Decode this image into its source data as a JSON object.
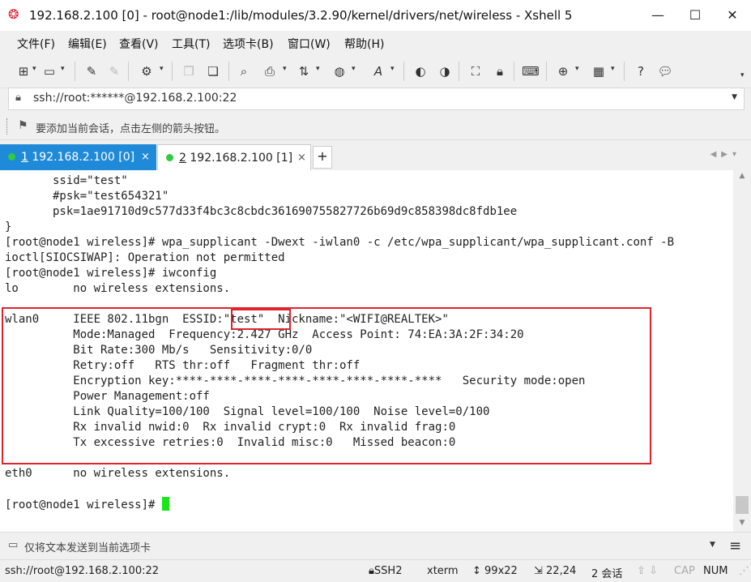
{
  "window": {
    "title": "192.168.2.100 [0] - root@node1:/lib/modules/3.2.90/kernel/drivers/net/wireless - Xshell 5",
    "app_icon": "xshell-logo-icon",
    "minimize_glyph": "—",
    "maximize_glyph": "☐",
    "close_glyph": "✕"
  },
  "menu": {
    "items": [
      "文件(F)",
      "编辑(E)",
      "查看(V)",
      "工具(T)",
      "选项卡(B)",
      "窗口(W)",
      "帮助(H)"
    ]
  },
  "toolbar": {
    "icons": [
      "new-session-icon",
      "open-folder-icon",
      "reconnect-icon",
      "disconnect-icon",
      "properties-icon",
      "copy-icon",
      "paste-icon",
      "print-icon",
      "transfer-icon",
      "globe-icon",
      "font-icon",
      "xftp-icon",
      "xagent-icon",
      "fullscreen-icon",
      "lock-icon",
      "keyboard-icon",
      "new-tab-icon",
      "layout-icon",
      "help-icon",
      "chat-icon"
    ]
  },
  "address": {
    "value": "ssh://root:******@192.168.2.100:22"
  },
  "hint": {
    "text": "要添加当前会话，点击左侧的箭头按钮。"
  },
  "tabs": [
    {
      "index": "1",
      "label": "192.168.2.100 [0]",
      "active": true
    },
    {
      "index": "2",
      "label": "192.168.2.100 [1]",
      "active": false
    }
  ],
  "tab_add_label": "+",
  "terminal": {
    "lines": [
      "       ssid=\"test\"",
      "       #psk=\"test654321\"",
      "       psk=1ae91710d9c577d33f4bc3c8cbdc361690755827726b69d9c858398dc8fdb1ee",
      "}",
      "[root@node1 wireless]# wpa_supplicant -Dwext -iwlan0 -c /etc/wpa_supplicant/wpa_supplicant.conf -B",
      "ioctl[SIOCSIWAP]: Operation not permitted",
      "[root@node1 wireless]# iwconfig",
      "lo        no wireless extensions.",
      "",
      "wlan0     IEEE 802.11bgn  ESSID:\"test\"  Nickname:\"<WIFI@REALTEK>\"",
      "          Mode:Managed  Frequency:2.427 GHz  Access Point: 74:EA:3A:2F:34:20",
      "          Bit Rate:300 Mb/s   Sensitivity:0/0",
      "          Retry:off   RTS thr:off   Fragment thr:off",
      "          Encryption key:****-****-****-****-****-****-****-****   Security mode:open",
      "          Power Management:off",
      "          Link Quality=100/100  Signal level=100/100  Noise level=0/100",
      "          Rx invalid nwid:0  Rx invalid crypt:0  Rx invalid frag:0",
      "          Tx excessive retries:0  Invalid misc:0   Missed beacon:0",
      "",
      "eth0      no wireless extensions.",
      "",
      "[root@node1 wireless]# "
    ]
  },
  "sendbar": {
    "text": "仅将文本发送到当前选项卡"
  },
  "status": {
    "connection": "ssh://root@192.168.2.100:22",
    "protocol": "SSH2",
    "terminal_type": "xterm",
    "size": "99x22",
    "position": "22,24",
    "sessions": "2 会话",
    "cap": "CAP",
    "num": "NUM"
  },
  "colors": {
    "tab_active": "#1f8ad8",
    "highlight": "#e0242e",
    "cursor": "#19e619"
  }
}
